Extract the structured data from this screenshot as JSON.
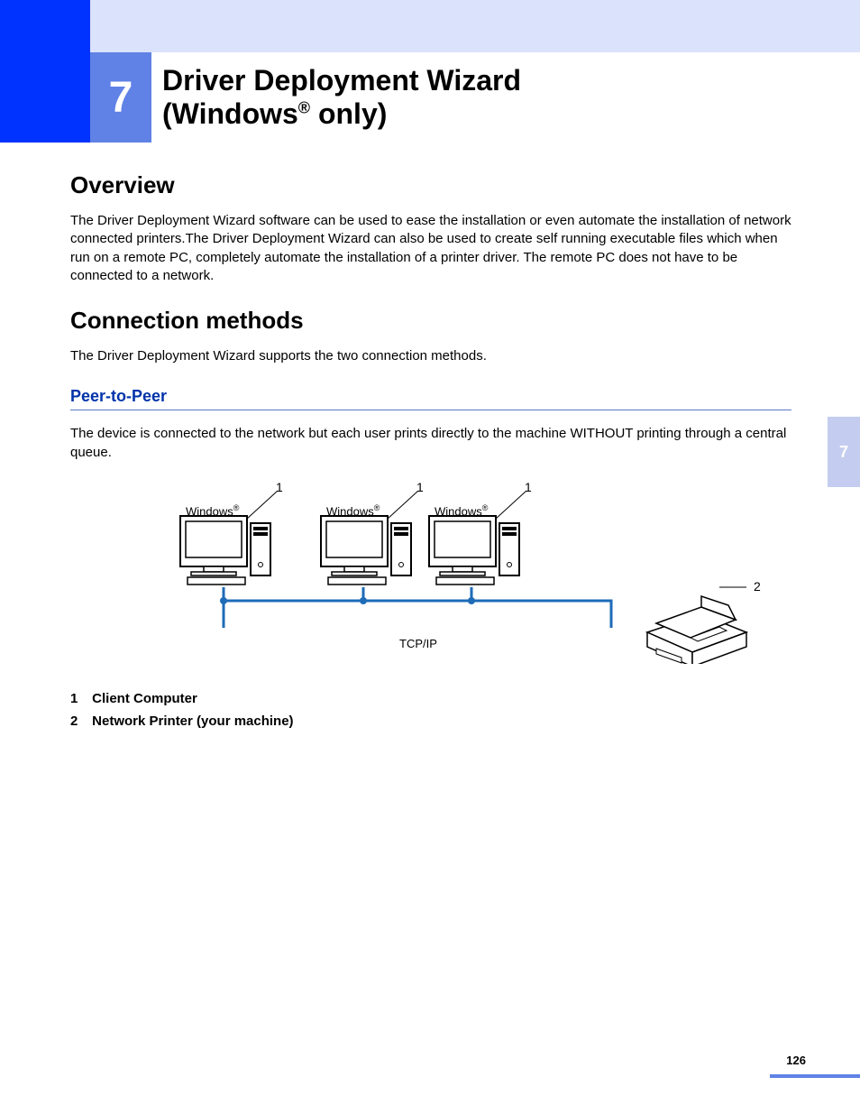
{
  "chapter": {
    "number": "7",
    "title_line1": "Driver Deployment Wizard",
    "title_line2_prefix": "(Windows",
    "title_line2_sup": "®",
    "title_line2_suffix": " only)"
  },
  "sections": {
    "overview": {
      "heading": "Overview",
      "body": "The Driver Deployment Wizard software can be used to ease the installation or even automate the installation of network connected printers.The Driver Deployment Wizard can also be used to create self running executable files which when run on a remote PC, completely automate the installation of a printer driver. The remote PC does not have to be connected to a network."
    },
    "connection": {
      "heading": "Connection methods",
      "intro": "The Driver Deployment Wizard supports the two connection methods."
    },
    "p2p": {
      "subheading": "Peer-to-Peer",
      "body": "The device is connected to the network but each user prints directly to the machine WITHOUT printing through a central queue."
    }
  },
  "diagram": {
    "pc_callout": "1",
    "pc_os_prefix": "Windows",
    "pc_os_sup": "®",
    "protocol": "TCP/IP",
    "printer_callout": "2"
  },
  "legend": [
    {
      "n": "1",
      "text": "Client Computer"
    },
    {
      "n": "2",
      "text": "Network Printer (your machine)"
    }
  ],
  "thumb_tab": "7",
  "page_number": "126"
}
